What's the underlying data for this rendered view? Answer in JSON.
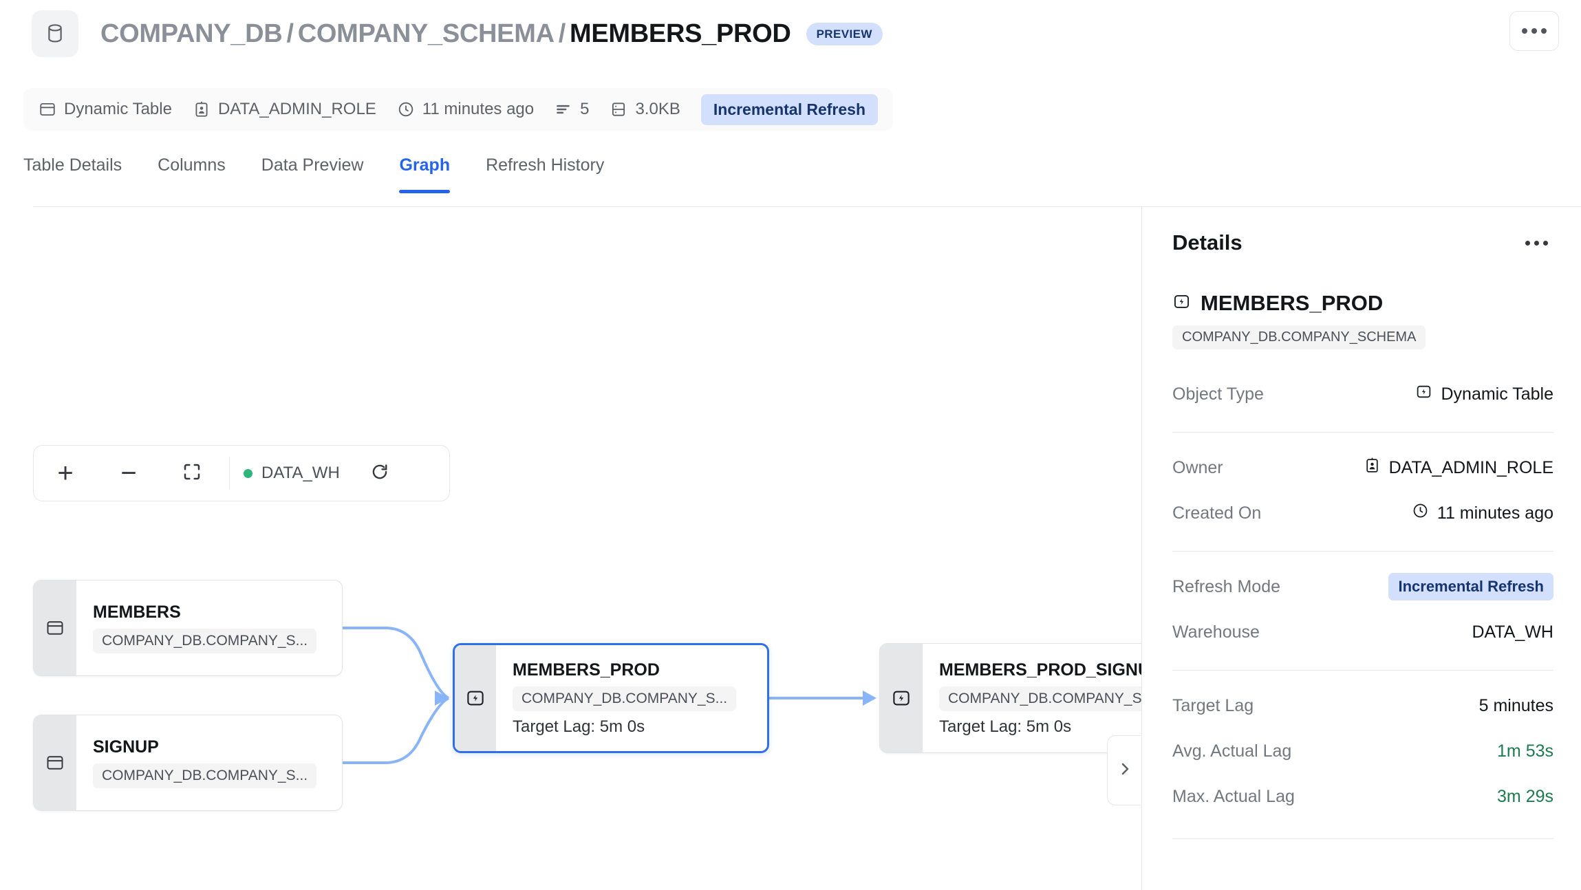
{
  "header": {
    "db_icon": "database-icon",
    "breadcrumb": {
      "database": "COMPANY_DB",
      "schema": "COMPANY_SCHEMA",
      "object": "MEMBERS_PROD",
      "separator": "/"
    },
    "preview_badge": "PREVIEW",
    "more_menu": "more-options"
  },
  "metabar": {
    "object_type": "Dynamic Table",
    "owner": "DATA_ADMIN_ROLE",
    "created": "11 minutes ago",
    "rows": "5",
    "size": "3.0KB",
    "refresh_mode": "Incremental Refresh"
  },
  "tabs": [
    {
      "label": "Table Details",
      "active": false
    },
    {
      "label": "Columns",
      "active": false
    },
    {
      "label": "Data Preview",
      "active": false
    },
    {
      "label": "Graph",
      "active": true
    },
    {
      "label": "Refresh History",
      "active": false
    }
  ],
  "graph_toolbar": {
    "zoom_in": "+",
    "zoom_out": "−",
    "fit_view": "fit-view-icon",
    "warehouse": "DATA_WH",
    "warehouse_status_color": "#2eb67d",
    "refresh": "refresh-icon"
  },
  "graph": {
    "nodes": [
      {
        "id": "members",
        "name": "MEMBERS",
        "path": "COMPANY_DB.COMPANY_S...",
        "icon": "table-icon",
        "lag": "",
        "selected": false
      },
      {
        "id": "signup",
        "name": "SIGNUP",
        "path": "COMPANY_DB.COMPANY_S...",
        "icon": "table-icon",
        "lag": "",
        "selected": false
      },
      {
        "id": "members_prod",
        "name": "MEMBERS_PROD",
        "path": "COMPANY_DB.COMPANY_S...",
        "icon": "dynamic-table-icon",
        "lag": "Target Lag: 5m 0s",
        "selected": true
      },
      {
        "id": "members_prod_signup",
        "name": "MEMBERS_PROD_SIGNUP",
        "path": "COMPANY_DB.COMPANY_S...",
        "icon": "dynamic-table-icon",
        "lag": "Target Lag: 5m 0s",
        "selected": false
      }
    ],
    "edge_color": "#8ab4f8",
    "collapse_handle": "chevron-right-icon"
  },
  "details": {
    "title": "Details",
    "more_menu": "more-options",
    "object_name": "MEMBERS_PROD",
    "object_path": "COMPANY_DB.COMPANY_SCHEMA",
    "rows": {
      "object_type_label": "Object Type",
      "object_type_value": "Dynamic Table",
      "owner_label": "Owner",
      "owner_value": "DATA_ADMIN_ROLE",
      "created_label": "Created On",
      "created_value": "11 minutes ago",
      "refresh_mode_label": "Refresh Mode",
      "refresh_mode_value": "Incremental Refresh",
      "warehouse_label": "Warehouse",
      "warehouse_value": "DATA_WH",
      "target_lag_label": "Target Lag",
      "target_lag_value": "5 minutes",
      "avg_lag_label": "Avg. Actual Lag",
      "avg_lag_value": "1m 53s",
      "max_lag_label": "Max. Actual Lag",
      "max_lag_value": "3m 29s"
    }
  },
  "colors": {
    "accent": "#2563eb",
    "badge_bg": "#d3e0fd",
    "badge_fg": "#16346e",
    "green": "#1e7a4f",
    "status_dot": "#2eb67d",
    "edge": "#8ab4f8"
  }
}
